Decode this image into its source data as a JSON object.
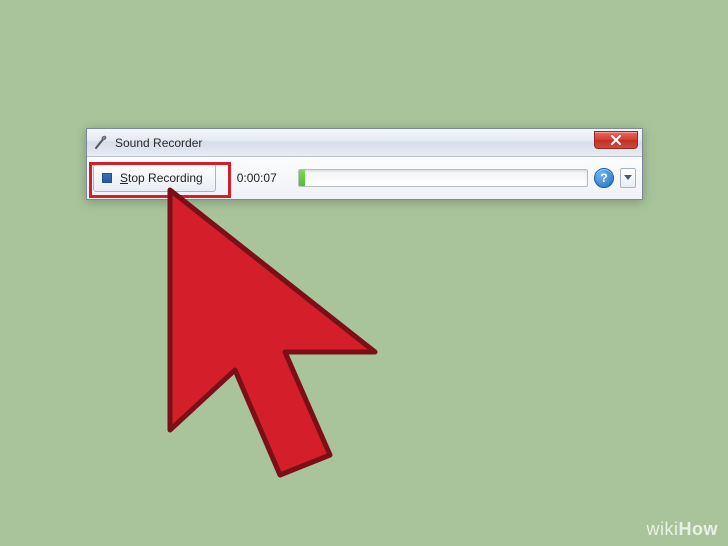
{
  "window": {
    "title": "Sound Recorder",
    "close_label": "Close"
  },
  "toolbar": {
    "stop_prefix": "S",
    "stop_rest": "top Recording",
    "timer": "0:00:07",
    "help_label": "?",
    "dropdown_label": "Options"
  },
  "watermark": {
    "wiki": "wiki",
    "how": "How"
  }
}
